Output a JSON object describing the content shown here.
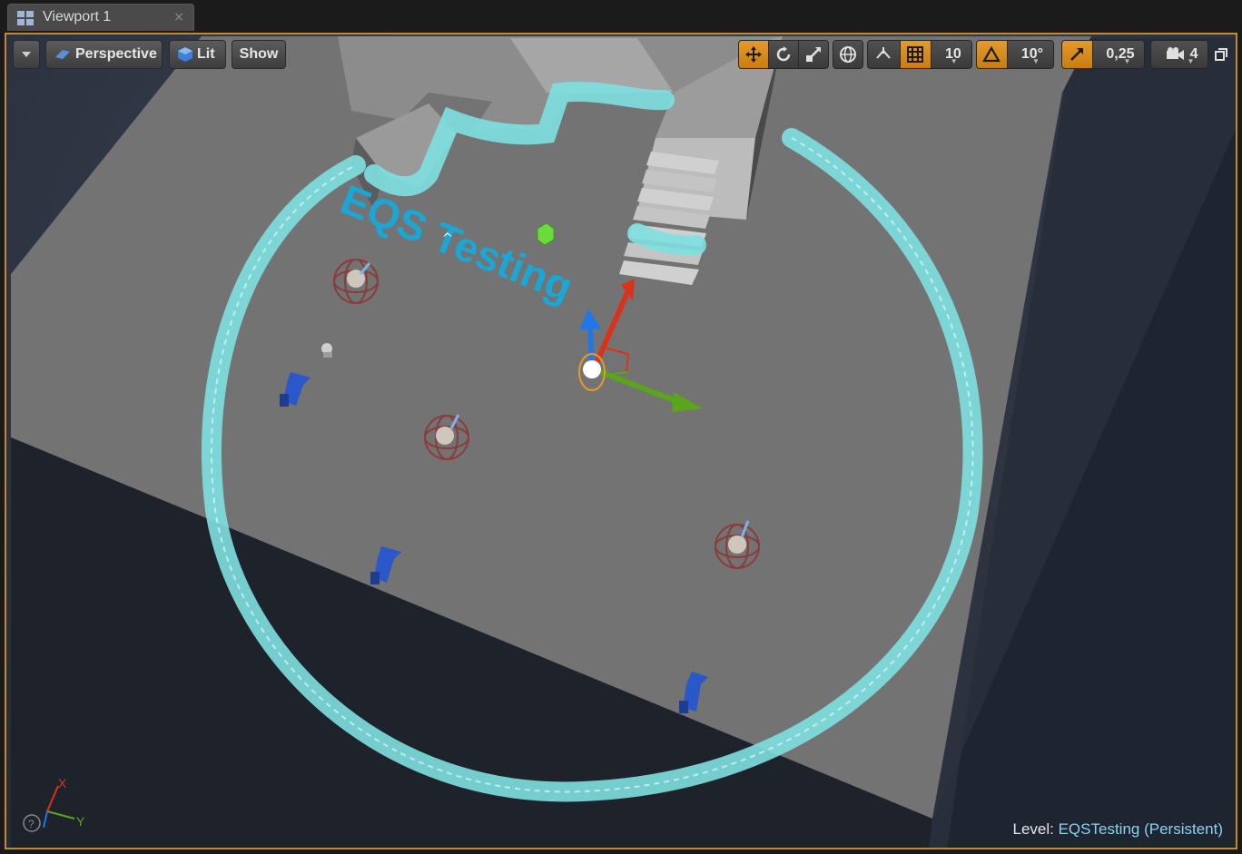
{
  "tab": {
    "label": "Viewport 1",
    "close_glyph": "×"
  },
  "toolbar": {
    "options_icon": "dropdown-arrow-icon",
    "perspective_label": "Perspective",
    "lit_label": "Lit",
    "show_label": "Show",
    "grid_snap_value": "10",
    "rotation_snap_value": "10°",
    "scale_snap_value": "0,25",
    "camera_speed_value": "4"
  },
  "scene": {
    "text_render_label": "EQS Testing"
  },
  "axis_indicator": {
    "x_label": "X",
    "y_label": "Y"
  },
  "status": {
    "level_prefix": "Level:",
    "level_name": "EQSTesting (Persistent)"
  },
  "colors": {
    "accent_orange": "#c8872a",
    "eqs_cyan": "#7fe0e0",
    "text_render_blue": "#1aa7d6",
    "gizmo_x_red": "#d8341c",
    "gizmo_y_green": "#5aa51c",
    "gizmo_z_blue": "#2277e6",
    "floor_gray": "#717171"
  }
}
